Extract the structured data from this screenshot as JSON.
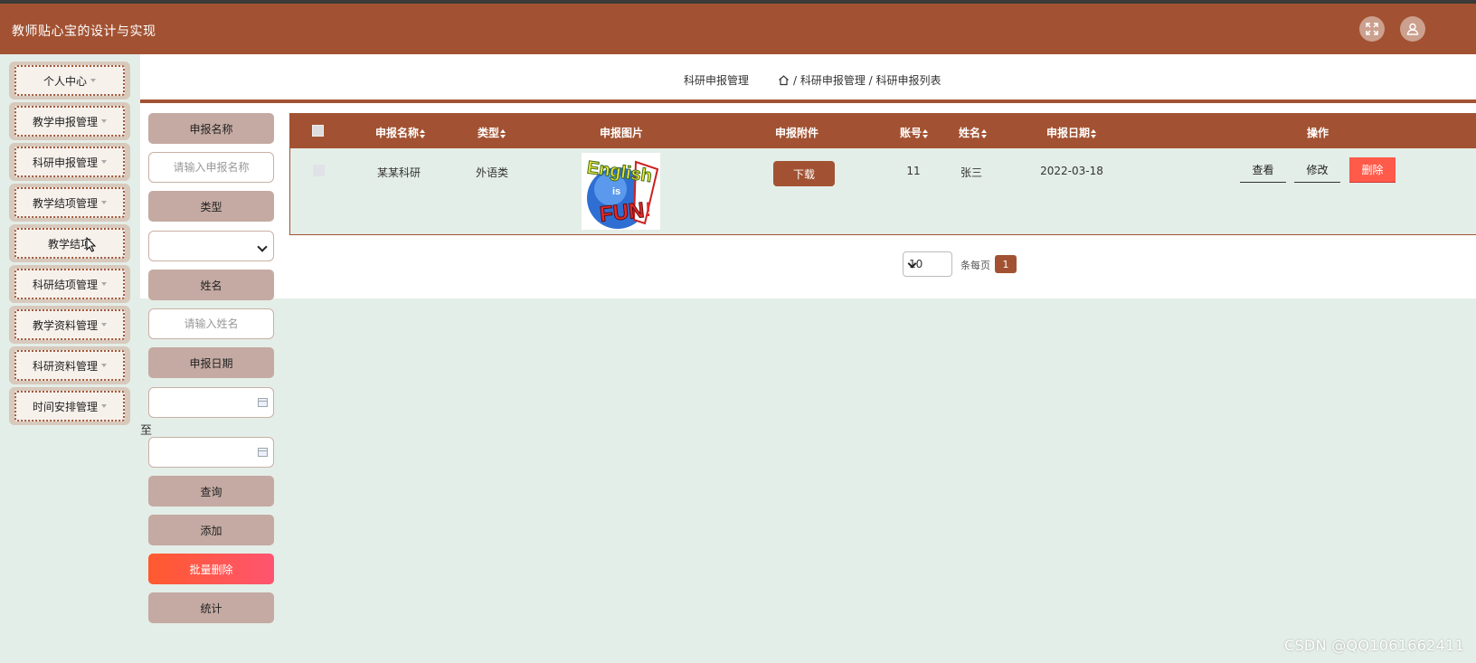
{
  "app": {
    "title": "教师贴心宝的设计与实现"
  },
  "header": {
    "fullscreen_icon": "expand-icon",
    "user_icon": "user-icon"
  },
  "sidebar": {
    "items": [
      {
        "label": "个人中心",
        "has_caret": true
      },
      {
        "label": "教学申报管理",
        "has_caret": true
      },
      {
        "label": "科研申报管理",
        "has_caret": true
      },
      {
        "label": "教学结项管理",
        "has_caret": true
      },
      {
        "label": "教学结项",
        "has_caret": false
      },
      {
        "label": "科研结项管理",
        "has_caret": true
      },
      {
        "label": "教学资料管理",
        "has_caret": true
      },
      {
        "label": "科研资料管理",
        "has_caret": true
      },
      {
        "label": "时间安排管理",
        "has_caret": true
      }
    ]
  },
  "breadcrumb": {
    "page_title": "科研申报管理",
    "home_icon": "home-icon",
    "path": "/ 科研申报管理 / 科研申报列表"
  },
  "search": {
    "name_label": "申报名称",
    "name_placeholder": "请输入申报名称",
    "type_label": "类型",
    "type_value": "",
    "person_label": "姓名",
    "person_placeholder": "请输入姓名",
    "date_label": "申报日期",
    "date_to": "至",
    "query_button": "查询",
    "add_button": "添加",
    "batch_delete_button": "批量删除",
    "stats_button": "统计"
  },
  "table": {
    "columns": [
      "申报名称",
      "类型",
      "申报图片",
      "申报附件",
      "账号",
      "姓名",
      "申报日期",
      "操作"
    ],
    "rows": [
      {
        "name": "某某科研",
        "type": "外语类",
        "image_alt": "English is FUN!",
        "attachment_button": "下载",
        "account": "11",
        "person": "张三",
        "date": "2022-03-18",
        "actions": {
          "view": "查看",
          "edit": "修改",
          "delete": "删除"
        }
      }
    ]
  },
  "pagination": {
    "page_size": "10",
    "per_page_label": "条每页",
    "current_page": "1"
  },
  "watermark": "CSDN @QQ1061662411",
  "colors": {
    "brand": "#a25232",
    "background": "#e4eee8",
    "danger": "#ff5a4a"
  }
}
